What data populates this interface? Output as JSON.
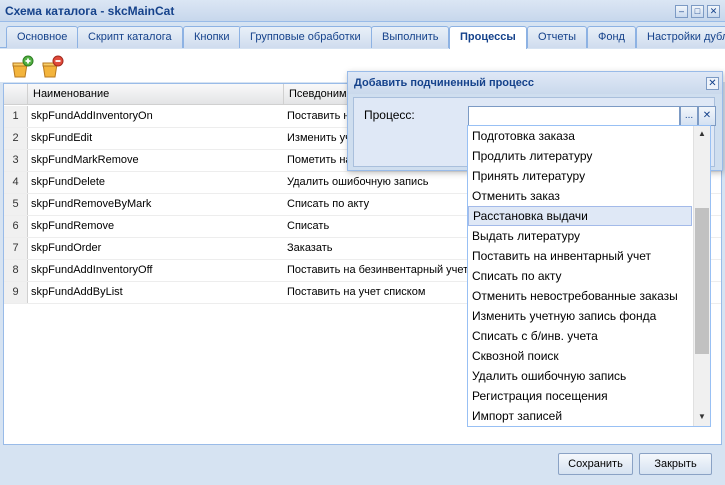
{
  "window": {
    "title": "Схема каталога - skcMainCat"
  },
  "tabs": [
    {
      "label": "Основное"
    },
    {
      "label": "Скрипт каталога"
    },
    {
      "label": "Кнопки"
    },
    {
      "label": "Групповые обработки"
    },
    {
      "label": "Выполнить"
    },
    {
      "label": "Процессы"
    },
    {
      "label": "Отчеты"
    },
    {
      "label": "Фонд"
    },
    {
      "label": "Настройки дубл"
    }
  ],
  "active_tab": "Процессы",
  "toolbar": {
    "add_icon": "add-process-icon",
    "remove_icon": "remove-process-icon"
  },
  "grid": {
    "columns": [
      "Наименование",
      "Псевдоним"
    ],
    "rows": [
      {
        "num": "1",
        "name": "skpFundAddInventoryOn",
        "alias": "Поставить н"
      },
      {
        "num": "2",
        "name": "skpFundEdit",
        "alias": "Изменить уч"
      },
      {
        "num": "3",
        "name": "skpFundMarkRemove",
        "alias": "Пометить на"
      },
      {
        "num": "4",
        "name": "skpFundDelete",
        "alias": "Удалить ошибочную запись"
      },
      {
        "num": "5",
        "name": "skpFundRemoveByMark",
        "alias": "Списать по акту"
      },
      {
        "num": "6",
        "name": "skpFundRemove",
        "alias": "Списать"
      },
      {
        "num": "7",
        "name": "skpFundOrder",
        "alias": "Заказать"
      },
      {
        "num": "8",
        "name": "skpFundAddInventoryOff",
        "alias": "Поставить на безинвентарный учет"
      },
      {
        "num": "9",
        "name": "skpFundAddByList",
        "alias": "Поставить на учет списком"
      }
    ]
  },
  "dialog": {
    "title": "Добавить подчиненный процесс",
    "field_label": "Процесс:",
    "field_value": "",
    "trigger_label": "...",
    "clear_label": "✕"
  },
  "dropdown": {
    "selected": "Расстановка выдачи",
    "items": [
      "Подготовка заказа",
      "Продлить литературу",
      "Принять литературу",
      "Отменить заказ",
      "Расстановка выдачи",
      "Выдать литературу",
      "Поставить на инвентарный учет",
      "Списать по акту",
      "Отменить невостребованные заказы",
      "Изменить учетную запись фонда",
      "Списать с б/инв. учета",
      "Сквозной поиск",
      "Удалить ошибочную запись",
      "Регистрация посещения",
      "Импорт записей"
    ]
  },
  "footer": {
    "save_label": "Сохранить",
    "close_label": "Закрыть"
  }
}
